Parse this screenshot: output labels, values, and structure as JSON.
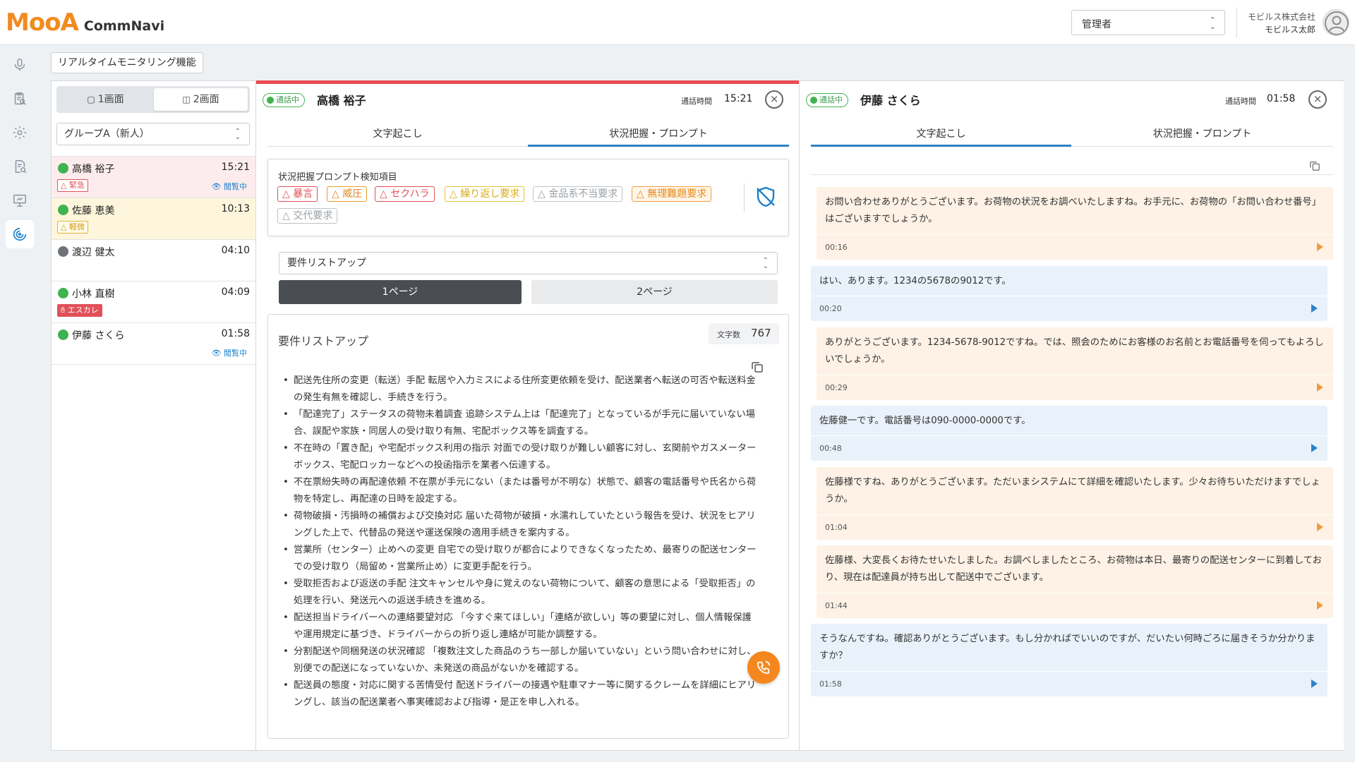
{
  "header": {
    "logo_main": "MooA",
    "logo_sub": "CommNavi",
    "role_select_value": "管理者",
    "company": "モビルス株式会社",
    "user_name": "モビルス太郎"
  },
  "nav": {
    "items": [
      {
        "icon": "microphone-icon"
      },
      {
        "icon": "clipboard-search-icon"
      },
      {
        "icon": "gear-icon"
      },
      {
        "icon": "document-search-icon"
      },
      {
        "icon": "presentation-icon"
      },
      {
        "icon": "monitoring-radar-icon",
        "active": true
      }
    ]
  },
  "feature_label": "リアルタイムモニタリング機能",
  "layout_toggle": {
    "one_screen": "1画面",
    "two_screen": "2画面",
    "active": "2画面"
  },
  "group_select": {
    "value": "グループA（新人）"
  },
  "operators": [
    {
      "name": "高橋 裕子",
      "time": "15:21",
      "status_color": "#3fb34f",
      "badge": "緊急",
      "badge_type": "urgent",
      "monitoring": "閲覧中",
      "row_state": "alert"
    },
    {
      "name": "佐藤 恵美",
      "time": "10:13",
      "status_color": "#3fb34f",
      "badge": "軽微",
      "badge_type": "light",
      "monitoring": "",
      "row_state": "warn"
    },
    {
      "name": "渡辺 健太",
      "time": "04:10",
      "status_color": "#6f7378",
      "badge": "",
      "badge_type": "",
      "monitoring": "",
      "row_state": ""
    },
    {
      "name": "小林 直樹",
      "time": "04:09",
      "status_color": "#3fb34f",
      "badge": "エスカレ",
      "badge_type": "esc",
      "monitoring": "",
      "row_state": ""
    },
    {
      "name": "伊藤 さくら",
      "time": "01:58",
      "status_color": "#3fb34f",
      "badge": "",
      "badge_type": "",
      "monitoring": "閲覧中",
      "row_state": ""
    }
  ],
  "panel_a": {
    "status": "通話中",
    "caller": "高橋 裕子",
    "call_time_label": "通話時間",
    "call_time": "15:21",
    "tabs": [
      "文字起こし",
      "状況把握・プロンプト"
    ],
    "active_tab": "状況把握・プロンプト",
    "detect_title": "状況把握プロンプト検知項目",
    "chips": [
      {
        "label": "暴言",
        "style": "red"
      },
      {
        "label": "威圧",
        "style": "orange"
      },
      {
        "label": "セクハラ",
        "style": "red"
      },
      {
        "label": "繰り返し要求",
        "style": "yellow"
      },
      {
        "label": "金品系不当要求",
        "style": "gray"
      },
      {
        "label": "無理難題要求",
        "style": "orange2"
      },
      {
        "label": "交代要求",
        "style": "gray"
      }
    ],
    "requirement_select": "要件リストアップ",
    "pages": [
      "1ページ",
      "2ページ"
    ],
    "active_page": "1ページ",
    "requirements_title": "要件リストアップ",
    "char_count_label": "文字数",
    "char_count": "767",
    "requirements": [
      "配送先住所の変更（転送）手配 転居や入力ミスによる住所変更依頼を受け、配送業者へ転送の可否や転送料金の発生有無を確認し、手続きを行う。",
      "「配達完了」ステータスの荷物未着調査 追跡システム上は「配達完了」となっているが手元に届いていない場合、誤配や家族・同居人の受け取り有無、宅配ボックス等を調査する。",
      "不在時の「置き配」や宅配ボックス利用の指示 対面での受け取りが難しい顧客に対し、玄関前やガスメーターボックス、宅配ロッカーなどへの投函指示を業者へ伝達する。",
      "不在票紛失時の再配達依頼 不在票が手元にない（または番号が不明な）状態で、顧客の電話番号や氏名から荷物を特定し、再配達の日時を設定する。",
      "荷物破損・汚損時の補償および交換対応 届いた荷物が破損・水濡れしていたという報告を受け、状況をヒアリングした上で、代替品の発送や運送保険の適用手続きを案内する。",
      "営業所（センター）止めへの変更 自宅での受け取りが都合によりできなくなったため、最寄りの配送センターでの受け取り（局留め・営業所止め）に変更手配を行う。",
      "受取拒否および返送の手配 注文キャンセルや身に覚えのない荷物について、顧客の意思による「受取拒否」の処理を行い、発送元への返送手続きを進める。",
      "配送担当ドライバーへの連絡要望対応 「今すぐ来てほしい」「連絡が欲しい」等の要望に対し、個人情報保護や運用規定に基づき、ドライバーからの折り返し連絡が可能か調整する。",
      "分割配送や同梱発送の状況確認 「複数注文した商品のうち一部しか届いていない」という問い合わせに対し、別便での配送になっていないか、未発送の商品がないかを確認する。",
      "配送員の態度・対応に関する苦情受付 配送ドライバーの接遇や駐車マナー等に関するクレームを詳細にヒアリングし、該当の配送業者へ事実確認および指導・是正を申し入れる。"
    ]
  },
  "panel_b": {
    "status": "通話中",
    "caller": "伊藤 さくら",
    "call_time_label": "通話時間",
    "call_time": "01:58",
    "tabs": [
      "文字起こし",
      "状況把握・プロンプト"
    ],
    "active_tab": "文字起こし",
    "messages": [
      {
        "speaker": "operator",
        "text": "お問い合わせありがとうございます。お荷物の状況をお調べいたしますね。お手元に、お荷物の「お問い合わせ番号」はございますでしょうか。",
        "time": "00:16"
      },
      {
        "speaker": "customer",
        "text": "はい、あります。1234の5678の9012です。",
        "time": "00:20"
      },
      {
        "speaker": "operator",
        "text": "ありがとうございます。1234-5678-9012ですね。では、照会のためにお客様のお名前とお電話番号を伺ってもよろしいでしょうか。",
        "time": "00:29"
      },
      {
        "speaker": "customer",
        "text": "佐藤健一です。電話番号は090-0000-0000です。",
        "time": "00:48"
      },
      {
        "speaker": "operator",
        "text": "佐藤様ですね、ありがとうございます。ただいまシステムにて詳細を確認いたします。少々お待ちいただけますでしょうか。",
        "time": "01:04"
      },
      {
        "speaker": "operator",
        "text": "佐藤様、大変長くお待たせいたしました。お調べしましたところ、お荷物は本日、最寄りの配送センターに到着しており、現在は配達員が持ち出して配送中でございます。",
        "time": "01:44"
      },
      {
        "speaker": "customer",
        "text": "そうなんですね。確認ありがとうございます。もし分かればでいいのですが、だいたい何時ごろに届きそうか分かりますか？",
        "time": "01:58"
      }
    ]
  }
}
